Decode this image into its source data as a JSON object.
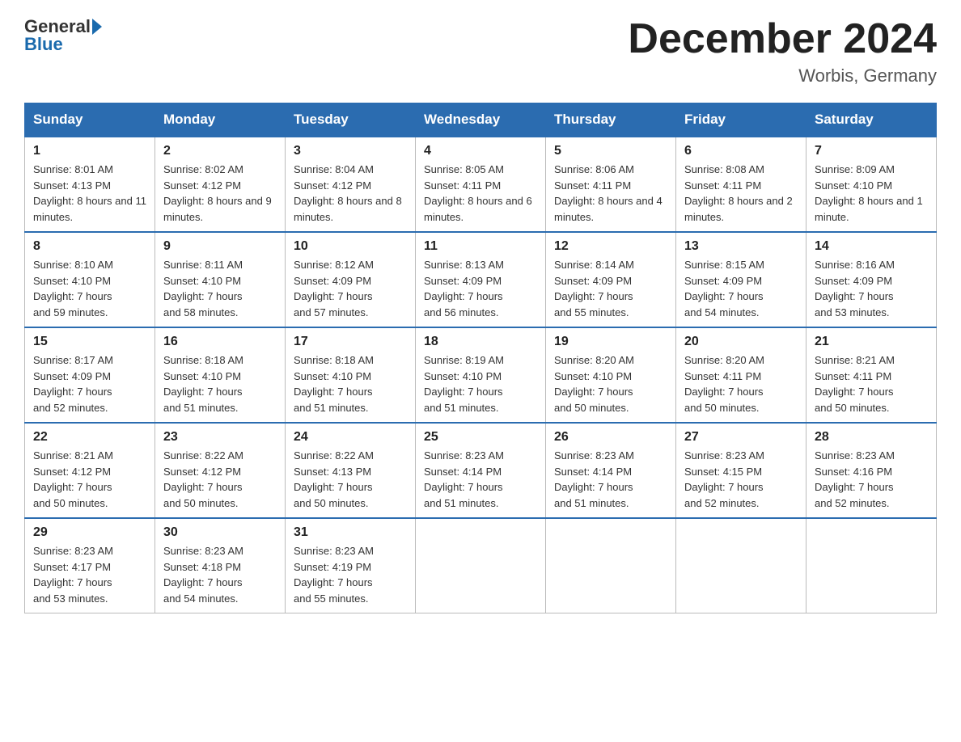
{
  "header": {
    "logo_general": "General",
    "logo_blue": "Blue",
    "month_title": "December 2024",
    "location": "Worbis, Germany"
  },
  "days_of_week": [
    "Sunday",
    "Monday",
    "Tuesday",
    "Wednesday",
    "Thursday",
    "Friday",
    "Saturday"
  ],
  "weeks": [
    [
      {
        "day": 1,
        "sunrise": "8:01 AM",
        "sunset": "4:13 PM",
        "daylight": "8 hours and 11 minutes."
      },
      {
        "day": 2,
        "sunrise": "8:02 AM",
        "sunset": "4:12 PM",
        "daylight": "8 hours and 9 minutes."
      },
      {
        "day": 3,
        "sunrise": "8:04 AM",
        "sunset": "4:12 PM",
        "daylight": "8 hours and 8 minutes."
      },
      {
        "day": 4,
        "sunrise": "8:05 AM",
        "sunset": "4:11 PM",
        "daylight": "8 hours and 6 minutes."
      },
      {
        "day": 5,
        "sunrise": "8:06 AM",
        "sunset": "4:11 PM",
        "daylight": "8 hours and 4 minutes."
      },
      {
        "day": 6,
        "sunrise": "8:08 AM",
        "sunset": "4:11 PM",
        "daylight": "8 hours and 2 minutes."
      },
      {
        "day": 7,
        "sunrise": "8:09 AM",
        "sunset": "4:10 PM",
        "daylight": "8 hours and 1 minute."
      }
    ],
    [
      {
        "day": 8,
        "sunrise": "8:10 AM",
        "sunset": "4:10 PM",
        "daylight": "7 hours and 59 minutes."
      },
      {
        "day": 9,
        "sunrise": "8:11 AM",
        "sunset": "4:10 PM",
        "daylight": "7 hours and 58 minutes."
      },
      {
        "day": 10,
        "sunrise": "8:12 AM",
        "sunset": "4:09 PM",
        "daylight": "7 hours and 57 minutes."
      },
      {
        "day": 11,
        "sunrise": "8:13 AM",
        "sunset": "4:09 PM",
        "daylight": "7 hours and 56 minutes."
      },
      {
        "day": 12,
        "sunrise": "8:14 AM",
        "sunset": "4:09 PM",
        "daylight": "7 hours and 55 minutes."
      },
      {
        "day": 13,
        "sunrise": "8:15 AM",
        "sunset": "4:09 PM",
        "daylight": "7 hours and 54 minutes."
      },
      {
        "day": 14,
        "sunrise": "8:16 AM",
        "sunset": "4:09 PM",
        "daylight": "7 hours and 53 minutes."
      }
    ],
    [
      {
        "day": 15,
        "sunrise": "8:17 AM",
        "sunset": "4:09 PM",
        "daylight": "7 hours and 52 minutes."
      },
      {
        "day": 16,
        "sunrise": "8:18 AM",
        "sunset": "4:10 PM",
        "daylight": "7 hours and 51 minutes."
      },
      {
        "day": 17,
        "sunrise": "8:18 AM",
        "sunset": "4:10 PM",
        "daylight": "7 hours and 51 minutes."
      },
      {
        "day": 18,
        "sunrise": "8:19 AM",
        "sunset": "4:10 PM",
        "daylight": "7 hours and 51 minutes."
      },
      {
        "day": 19,
        "sunrise": "8:20 AM",
        "sunset": "4:10 PM",
        "daylight": "7 hours and 50 minutes."
      },
      {
        "day": 20,
        "sunrise": "8:20 AM",
        "sunset": "4:11 PM",
        "daylight": "7 hours and 50 minutes."
      },
      {
        "day": 21,
        "sunrise": "8:21 AM",
        "sunset": "4:11 PM",
        "daylight": "7 hours and 50 minutes."
      }
    ],
    [
      {
        "day": 22,
        "sunrise": "8:21 AM",
        "sunset": "4:12 PM",
        "daylight": "7 hours and 50 minutes."
      },
      {
        "day": 23,
        "sunrise": "8:22 AM",
        "sunset": "4:12 PM",
        "daylight": "7 hours and 50 minutes."
      },
      {
        "day": 24,
        "sunrise": "8:22 AM",
        "sunset": "4:13 PM",
        "daylight": "7 hours and 50 minutes."
      },
      {
        "day": 25,
        "sunrise": "8:23 AM",
        "sunset": "4:14 PM",
        "daylight": "7 hours and 51 minutes."
      },
      {
        "day": 26,
        "sunrise": "8:23 AM",
        "sunset": "4:14 PM",
        "daylight": "7 hours and 51 minutes."
      },
      {
        "day": 27,
        "sunrise": "8:23 AM",
        "sunset": "4:15 PM",
        "daylight": "7 hours and 52 minutes."
      },
      {
        "day": 28,
        "sunrise": "8:23 AM",
        "sunset": "4:16 PM",
        "daylight": "7 hours and 52 minutes."
      }
    ],
    [
      {
        "day": 29,
        "sunrise": "8:23 AM",
        "sunset": "4:17 PM",
        "daylight": "7 hours and 53 minutes."
      },
      {
        "day": 30,
        "sunrise": "8:23 AM",
        "sunset": "4:18 PM",
        "daylight": "7 hours and 54 minutes."
      },
      {
        "day": 31,
        "sunrise": "8:23 AM",
        "sunset": "4:19 PM",
        "daylight": "7 hours and 55 minutes."
      },
      null,
      null,
      null,
      null
    ]
  ],
  "labels": {
    "sunrise": "Sunrise:",
    "sunset": "Sunset:",
    "daylight": "Daylight:"
  }
}
